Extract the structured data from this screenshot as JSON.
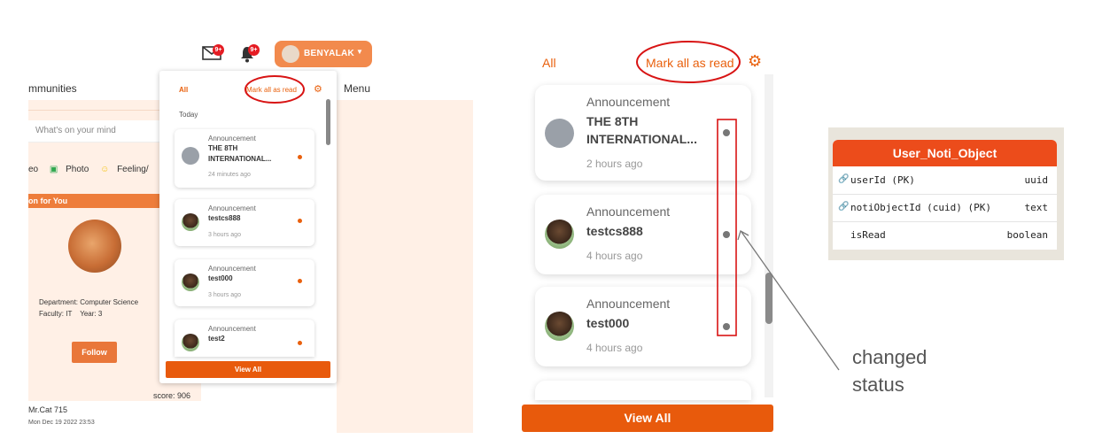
{
  "left": {
    "header": {
      "mail_badge": "9+",
      "bell_badge": "9+",
      "user_name": "BENYALAK"
    },
    "communities_title": "mmunities",
    "menu_title": "Menu",
    "composer_placeholder": "What's on your mind",
    "post_options": {
      "video": "eo",
      "photo": "Photo",
      "feeling": "Feeling/"
    },
    "suggestion_title": "on for You",
    "profile": {
      "department": "Department: Computer Science",
      "faculty": "Faculty: IT",
      "year": "Year: 3",
      "follow_label": "Follow",
      "score": "score: 906",
      "name": "Mr.Cat 715",
      "date": "Mon Dec 19 2022 23:53"
    },
    "dropdown": {
      "tab_all": "All",
      "mark_all": "Mark all as read",
      "section_today": "Today",
      "items": [
        {
          "type": "Announcement",
          "title": "THE 8TH INTERNATIONAL...",
          "time": "24 minutes ago"
        },
        {
          "type": "Announcement",
          "title": "testcs888",
          "time": "3 hours ago"
        },
        {
          "type": "Announcement",
          "title": "test000",
          "time": "3 hours ago"
        },
        {
          "type": "Announcement",
          "title": "test2",
          "time": ""
        }
      ],
      "view_all": "View All"
    }
  },
  "middle": {
    "tab_all": "All",
    "mark_all": "Mark all as read",
    "items": [
      {
        "type": "Announcement",
        "title": "THE 8TH INTERNATIONAL...",
        "time": "2 hours ago"
      },
      {
        "type": "Announcement",
        "title": "testcs888",
        "time": "4 hours ago"
      },
      {
        "type": "Announcement",
        "title": "test000",
        "time": "4 hours ago"
      }
    ],
    "view_all": "View All",
    "annotation": "changed status"
  },
  "table": {
    "name": "User_Noti_Object",
    "rows": [
      {
        "field": "userId (PK)",
        "type": "uuid"
      },
      {
        "field": "notiObjectId (cuid) (PK)",
        "type": "text"
      },
      {
        "field": "isRead",
        "type": "boolean"
      }
    ]
  },
  "colors": {
    "accent": "#e85a0c",
    "highlight_circle": "#d81414",
    "table_header": "#ec4c1b"
  }
}
